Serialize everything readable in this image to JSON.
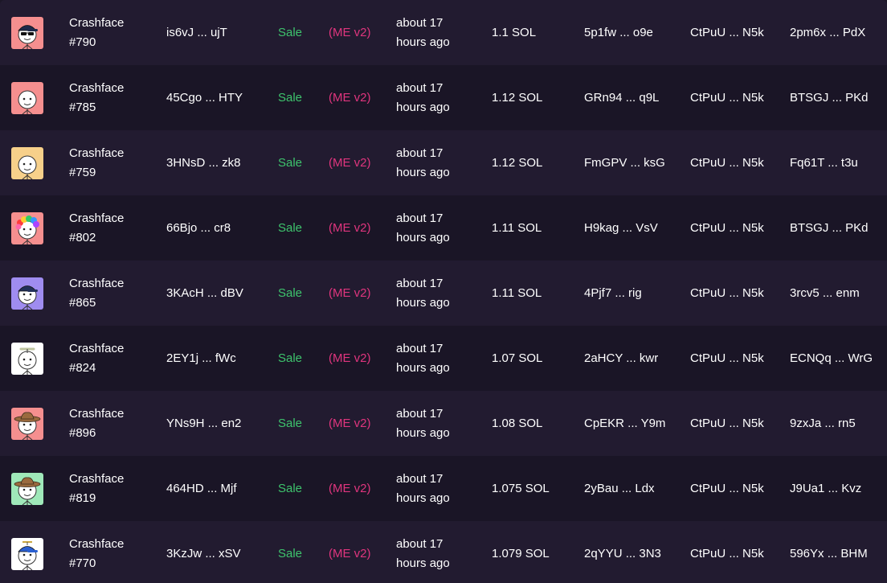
{
  "rows": [
    {
      "name": "Crashface",
      "number": "#790",
      "tx": "is6vJ ... ujT",
      "type": "Sale",
      "market": "(ME v2)",
      "time_line1": "about 17",
      "time_line2": "hours ago",
      "price": "1.1 SOL",
      "buyer": "5p1fw ... o9e",
      "seller": "CtPuU ... N5k",
      "auth": "2pm6x ... PdX",
      "bg": "#f58f8f",
      "accessory": "cap-shades",
      "acc_color": "#1e2a4a"
    },
    {
      "name": "Crashface",
      "number": "#785",
      "tx": "45Cgo ... HTY",
      "type": "Sale",
      "market": "(ME v2)",
      "time_line1": "about 17",
      "time_line2": "hours ago",
      "price": "1.12 SOL",
      "buyer": "GRn94 ... q9L",
      "seller": "CtPuU ... N5k",
      "auth": "BTSGJ ... PKd",
      "bg": "#f58f8f",
      "accessory": "none",
      "acc_color": "#ffffff"
    },
    {
      "name": "Crashface",
      "number": "#759",
      "tx": "3HNsD ... zk8",
      "type": "Sale",
      "market": "(ME v2)",
      "time_line1": "about 17",
      "time_line2": "hours ago",
      "price": "1.12 SOL",
      "buyer": "FmGPV ... ksG",
      "seller": "CtPuU ... N5k",
      "auth": "Fq61T ... t3u",
      "bg": "#f7d08a",
      "accessory": "none",
      "acc_color": "#ffffff"
    },
    {
      "name": "Crashface",
      "number": "#802",
      "tx": "66Bjo ... cr8",
      "type": "Sale",
      "market": "(ME v2)",
      "time_line1": "about 17",
      "time_line2": "hours ago",
      "price": "1.11 SOL",
      "buyer": "H9kag ... VsV",
      "seller": "CtPuU ... N5k",
      "auth": "BTSGJ ... PKd",
      "bg": "#f58f8f",
      "accessory": "rainbow-hair",
      "acc_color": "#e0357e"
    },
    {
      "name": "Crashface",
      "number": "#865",
      "tx": "3KAcH ... dBV",
      "type": "Sale",
      "market": "(ME v2)",
      "time_line1": "about 17",
      "time_line2": "hours ago",
      "price": "1.11 SOL",
      "buyer": "4Pjf7 ... rig",
      "seller": "CtPuU ... N5k",
      "auth": "3rcv5 ... enm",
      "bg": "#9f8cf0",
      "accessory": "cap",
      "acc_color": "#22305a"
    },
    {
      "name": "Crashface",
      "number": "#824",
      "tx": "2EY1j ... fWc",
      "type": "Sale",
      "market": "(ME v2)",
      "time_line1": "about 17",
      "time_line2": "hours ago",
      "price": "1.07 SOL",
      "buyer": "2aHCY ... kwr",
      "seller": "CtPuU ... N5k",
      "auth": "ECNQq ... WrG",
      "bg": "#ffffff",
      "accessory": "propeller",
      "acc_color": "#bfc4a0"
    },
    {
      "name": "Crashface",
      "number": "#896",
      "tx": "YNs9H ... en2",
      "type": "Sale",
      "market": "(ME v2)",
      "time_line1": "about 17",
      "time_line2": "hours ago",
      "price": "1.08 SOL",
      "buyer": "CpEKR ... Y9m",
      "seller": "CtPuU ... N5k",
      "auth": "9zxJa ... rn5",
      "bg": "#f58f8f",
      "accessory": "cowboy",
      "acc_color": "#9a6a3e"
    },
    {
      "name": "Crashface",
      "number": "#819",
      "tx": "464HD ... Mjf",
      "type": "Sale",
      "market": "(ME v2)",
      "time_line1": "about 17",
      "time_line2": "hours ago",
      "price": "1.075 SOL",
      "buyer": "2yBau ... Ldx",
      "seller": "CtPuU ... N5k",
      "auth": "J9Ua1 ... Kvz",
      "bg": "#9fe8b9",
      "accessory": "cowboy",
      "acc_color": "#9a6a3e"
    },
    {
      "name": "Crashface",
      "number": "#770",
      "tx": "3KzJw ... xSV",
      "type": "Sale",
      "market": "(ME v2)",
      "time_line1": "about 17",
      "time_line2": "hours ago",
      "price": "1.079 SOL",
      "buyer": "2qYYU ... 3N3",
      "seller": "CtPuU ... N5k",
      "auth": "596Yx ... BHM",
      "bg": "#ffffff",
      "accessory": "propeller-cap",
      "acc_color": "#2a5fd0"
    }
  ]
}
